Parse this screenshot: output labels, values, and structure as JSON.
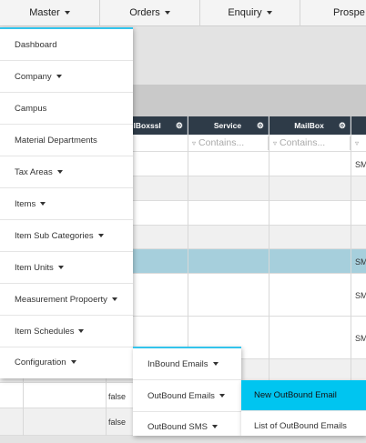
{
  "topnav": {
    "master": "Master",
    "orders": "Orders",
    "enquiry": "Enquiry",
    "prospects": "Prospe"
  },
  "grid": {
    "headers": [
      "ilBoxssl",
      "Service",
      "MailBox",
      ""
    ],
    "filter_placeholder": "Contains...",
    "sms_label": "SM",
    "false_label": "false"
  },
  "master_menu": {
    "items": [
      {
        "label": "Dashboard",
        "caret": false
      },
      {
        "label": "Company",
        "caret": true
      },
      {
        "label": "Campus",
        "caret": false
      },
      {
        "label": "Material Departments",
        "caret": false
      },
      {
        "label": "Tax Areas",
        "caret": true
      },
      {
        "label": "Items",
        "caret": true
      },
      {
        "label": "Item Sub Categories",
        "caret": true
      },
      {
        "label": "Item Units",
        "caret": true
      },
      {
        "label": "Measurement Propoerty",
        "caret": true
      },
      {
        "label": "Item Schedules",
        "caret": true
      },
      {
        "label": "Configuration",
        "caret": true
      }
    ]
  },
  "configuration_menu": {
    "items": [
      {
        "label": "InBound Emails"
      },
      {
        "label": "OutBound Emails"
      },
      {
        "label": "OutBound SMS"
      }
    ]
  },
  "outbound_menu": {
    "items": [
      {
        "label": "New OutBound Email"
      },
      {
        "label": "List of OutBound Emails"
      }
    ]
  },
  "colors": {
    "accent": "#33c4ec",
    "highlight": "#00c5f0",
    "grid_header": "#2e3b48",
    "selected_row": "#a6cfdc"
  }
}
